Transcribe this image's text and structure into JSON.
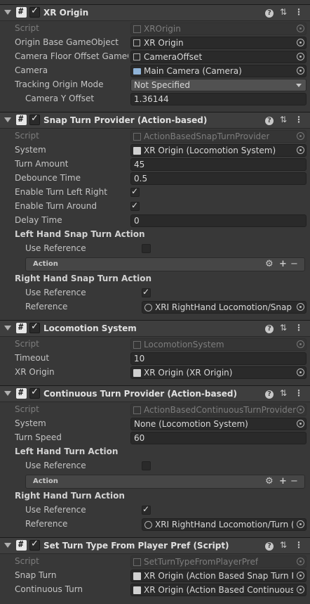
{
  "xr_origin": {
    "title": "XR Origin",
    "script_label": "Script",
    "script_value": "XROrigin",
    "origin_base_label": "Origin Base GameObject",
    "origin_base_value": "XR Origin",
    "camera_floor_label": "Camera Floor Offset GameOb",
    "camera_floor_value": "CameraOffset",
    "camera_label": "Camera",
    "camera_value": "Main Camera (Camera)",
    "tracking_label": "Tracking Origin Mode",
    "tracking_value": "Not Specified",
    "camera_y_label": "Camera Y Offset",
    "camera_y_value": "1.36144"
  },
  "snap_turn": {
    "title": "Snap Turn Provider (Action-based)",
    "script_label": "Script",
    "script_value": "ActionBasedSnapTurnProvider",
    "system_label": "System",
    "system_value": "XR Origin (Locomotion System)",
    "turn_amount_label": "Turn Amount",
    "turn_amount_value": "45",
    "debounce_label": "Debounce Time",
    "debounce_value": "0.5",
    "enable_lr_label": "Enable Turn Left Right",
    "enable_around_label": "Enable Turn Around",
    "delay_label": "Delay Time",
    "delay_value": "0",
    "left_section": "Left Hand Snap Turn Action",
    "left_use_ref_label": "Use Reference",
    "left_action_label": "Action",
    "right_section": "Right Hand Snap Turn Action",
    "right_use_ref_label": "Use Reference",
    "right_ref_label": "Reference",
    "right_ref_value": "XRI RightHand Locomotion/Snap Tu"
  },
  "locomotion": {
    "title": "Locomotion System",
    "script_label": "Script",
    "script_value": "LocomotionSystem",
    "timeout_label": "Timeout",
    "timeout_value": "10",
    "xr_origin_label": "XR Origin",
    "xr_origin_value": "XR Origin (XR Origin)"
  },
  "continuous_turn": {
    "title": "Continuous Turn Provider (Action-based)",
    "script_label": "Script",
    "script_value": "ActionBasedContinuousTurnProvider",
    "system_label": "System",
    "system_value": "None (Locomotion System)",
    "turn_speed_label": "Turn Speed",
    "turn_speed_value": "60",
    "left_section": "Left Hand Turn Action",
    "left_use_ref_label": "Use Reference",
    "left_action_label": "Action",
    "right_section": "Right Hand Turn Action",
    "right_use_ref_label": "Use Reference",
    "right_ref_label": "Reference",
    "right_ref_value": "XRI RightHand Locomotion/Turn (Inp"
  },
  "set_turn_type": {
    "title": "Set Turn Type From Player Pref (Script)",
    "script_label": "Script",
    "script_value": "SetTurnTypeFromPlayerPref",
    "snap_turn_label": "Snap Turn",
    "snap_turn_value": "XR Origin (Action Based Snap Turn Pro",
    "continuous_label": "Continuous Turn",
    "continuous_value": "XR Origin (Action Based Continuous Tu"
  },
  "icons": {
    "help": "?",
    "preset": "⇅",
    "menu": "⋮",
    "gear": "⚙",
    "add": "+",
    "remove": "−"
  }
}
